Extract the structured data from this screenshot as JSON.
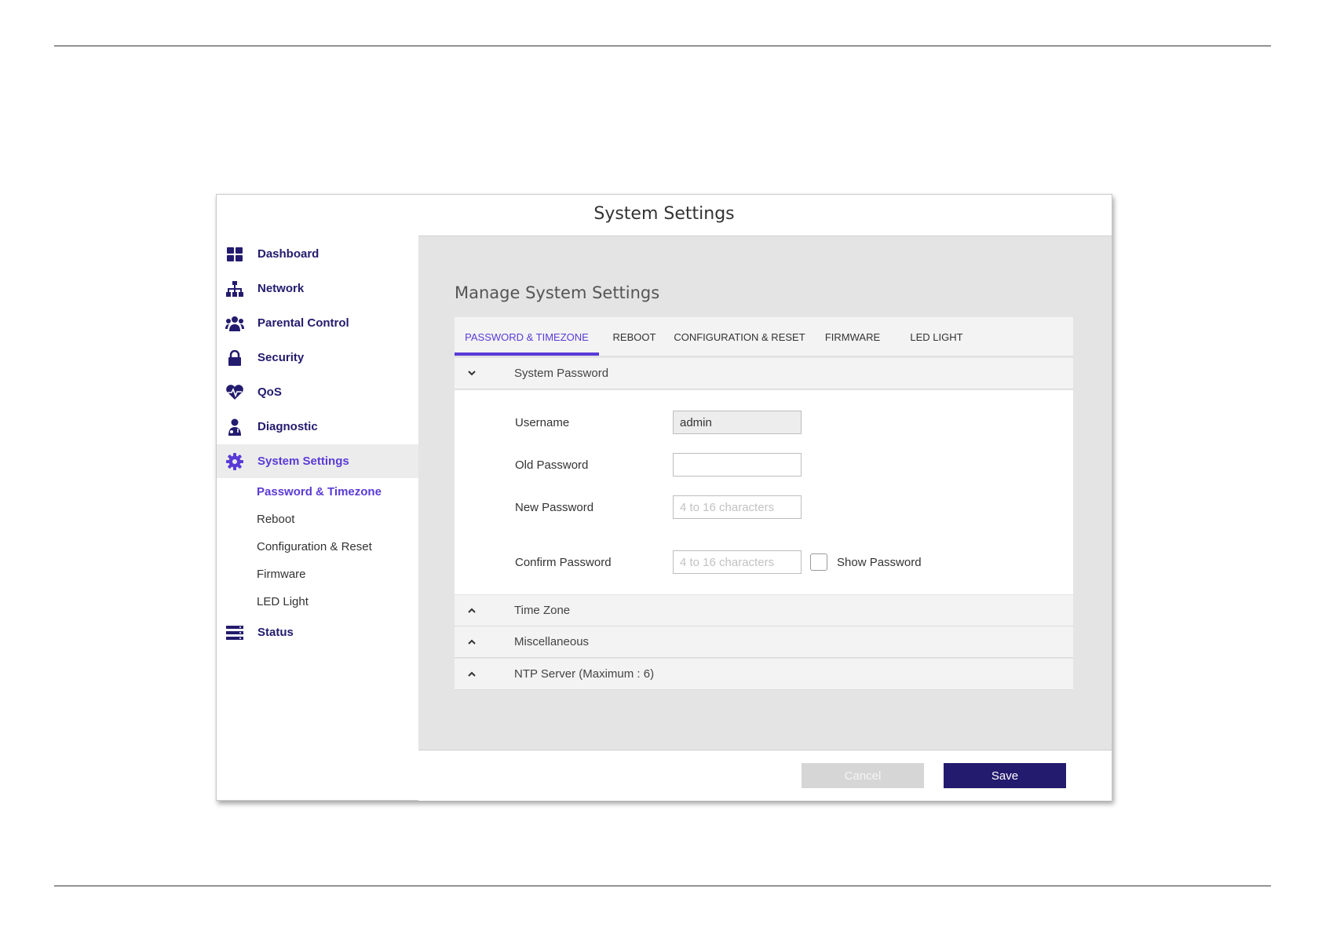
{
  "window": {
    "title": "System Settings"
  },
  "sidebar": {
    "items": [
      {
        "label": "Dashboard",
        "icon": "dashboard-grid-icon"
      },
      {
        "label": "Network",
        "icon": "network-tree-icon"
      },
      {
        "label": "Parental Control",
        "icon": "users-group-icon"
      },
      {
        "label": "Security",
        "icon": "lock-icon"
      },
      {
        "label": "QoS",
        "icon": "heartbeat-icon"
      },
      {
        "label": "Diagnostic",
        "icon": "doctor-icon"
      },
      {
        "label": "System Settings",
        "icon": "gear-icon",
        "active": true
      },
      {
        "label": "Status",
        "icon": "server-list-icon"
      }
    ],
    "sub_items": [
      {
        "label": "Password & Timezone",
        "active": true
      },
      {
        "label": "Reboot"
      },
      {
        "label": "Configuration & Reset"
      },
      {
        "label": "Firmware"
      },
      {
        "label": "LED Light"
      }
    ]
  },
  "main": {
    "heading": "Manage System Settings",
    "tabs": [
      {
        "label": "PASSWORD & TIMEZONE",
        "active": true
      },
      {
        "label": "REBOOT"
      },
      {
        "label": "CONFIGURATION & RESET"
      },
      {
        "label": "FIRMWARE"
      },
      {
        "label": "LED LIGHT"
      }
    ],
    "sections": {
      "system_password": {
        "label": "System Password",
        "expanded": true
      },
      "time_zone": {
        "label": "Time Zone"
      },
      "miscellaneous": {
        "label": "Miscellaneous"
      },
      "ntp_server": {
        "label": "NTP Server (Maximum : 6)"
      }
    },
    "form": {
      "username": {
        "label": "Username",
        "value": "admin"
      },
      "old_password": {
        "label": "Old Password",
        "value": ""
      },
      "new_password": {
        "label": "New Password",
        "placeholder": "4 to 16 characters"
      },
      "confirm_password": {
        "label": "Confirm Password",
        "placeholder": "4 to 16 characters"
      },
      "show_password": {
        "label": "Show Password",
        "checked": false
      }
    }
  },
  "footer": {
    "cancel_label": "Cancel",
    "save_label": "Save"
  },
  "colors": {
    "brand": "#231b6e",
    "accent": "#5a3bd6",
    "panel_bg": "#e4e4e4",
    "cancel_bg": "#d6d6d6"
  }
}
